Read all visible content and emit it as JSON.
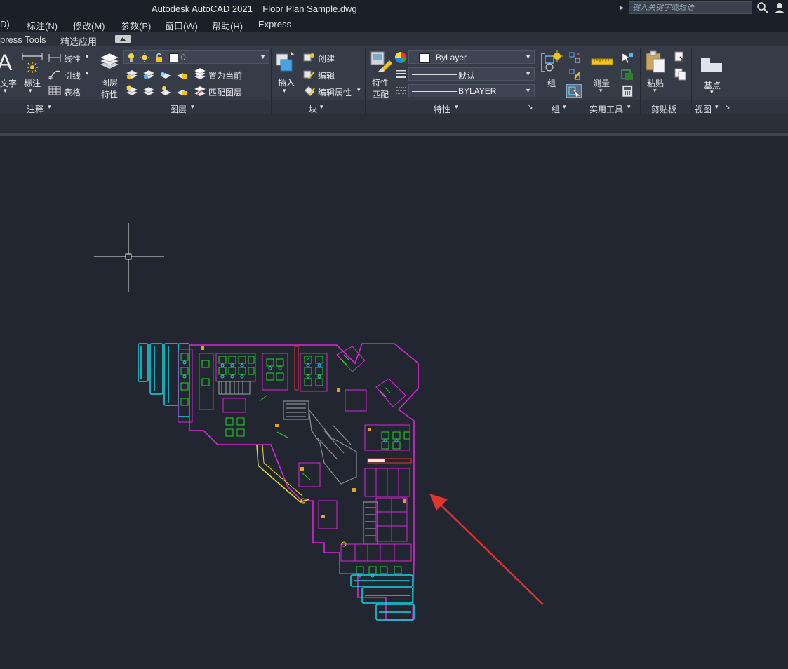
{
  "window": {
    "title": "Autodesk AutoCAD 2021    Floor Plan Sample.dwg",
    "search_placeholder": "键入关键字或短语"
  },
  "menu": [
    "D)",
    "标注(N)",
    "修改(M)",
    "参数(P)",
    "窗口(W)",
    "帮助(H)",
    "Express"
  ],
  "tabs": [
    "press Tools",
    "精选应用"
  ],
  "ribbon": {
    "annotation": {
      "text_label": "文字",
      "dim_label": "标注",
      "linear": "线性",
      "leader": "引线",
      "table": "表格",
      "title": "注释"
    },
    "layers": {
      "layer_props_label": "图层\n特性",
      "layer_props_line1": "图层",
      "layer_props_line2": "特性",
      "current_layer": "0",
      "set_current": "置为当前",
      "match_layer": "匹配图层",
      "title": "图层"
    },
    "block": {
      "insert": "插入",
      "create": "创建",
      "edit": "编辑",
      "edit_attr": "编辑属性",
      "title": "块"
    },
    "properties": {
      "match_line1": "特性",
      "match_line2": "匹配",
      "color": "ByLayer",
      "linetype": "默认",
      "lineweight": "BYLAYER",
      "title": "特性"
    },
    "groups": {
      "group": "组",
      "title": "组"
    },
    "utilities": {
      "measure": "测量",
      "title": "实用工具"
    },
    "clipboard": {
      "paste": "粘贴",
      "title": "剪贴板"
    },
    "view": {
      "basepoint": "基点",
      "title": "视图"
    }
  },
  "colors": {
    "background": "#212630",
    "ribbon": "#353b47",
    "arrow": "#e0322f",
    "cyan": "#19d3e0",
    "magenta": "#d628d6",
    "green": "#2cd12c",
    "yellow": "#e3e02a"
  }
}
